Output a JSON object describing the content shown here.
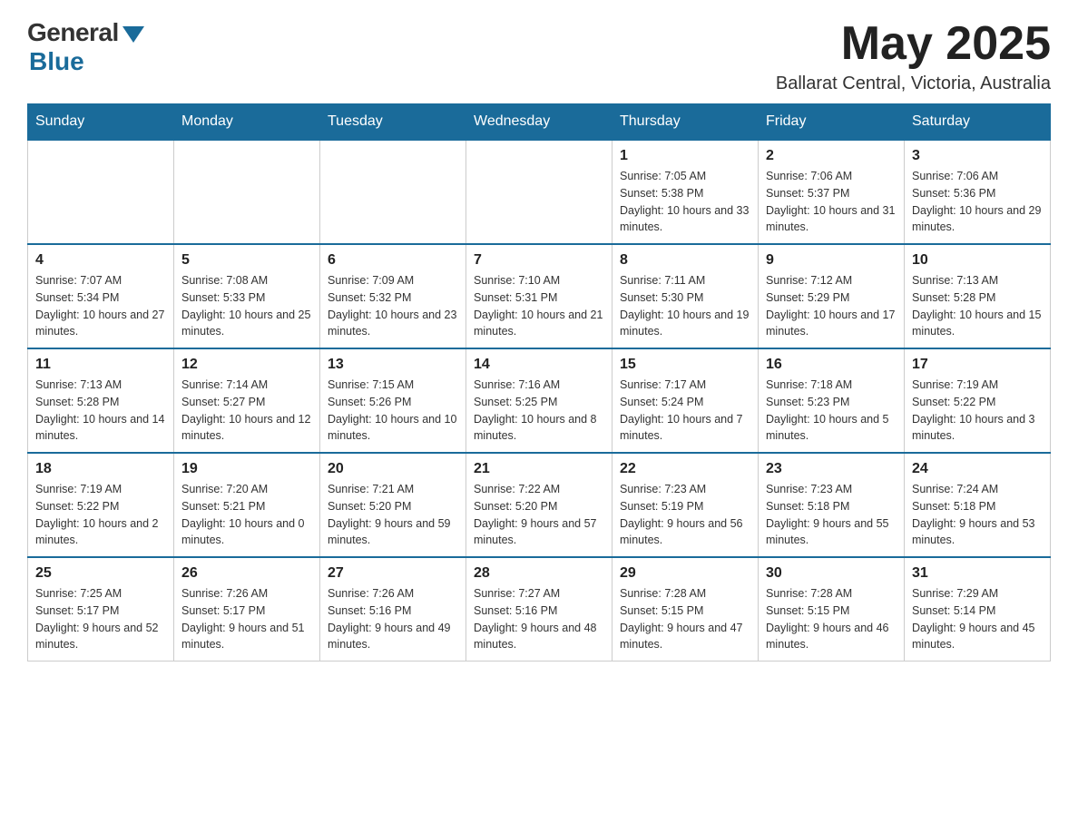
{
  "header": {
    "logo_general": "General",
    "logo_blue": "Blue",
    "month_title": "May 2025",
    "location": "Ballarat Central, Victoria, Australia"
  },
  "weekdays": [
    "Sunday",
    "Monday",
    "Tuesday",
    "Wednesday",
    "Thursday",
    "Friday",
    "Saturday"
  ],
  "weeks": [
    [
      {
        "day": "",
        "info": ""
      },
      {
        "day": "",
        "info": ""
      },
      {
        "day": "",
        "info": ""
      },
      {
        "day": "",
        "info": ""
      },
      {
        "day": "1",
        "info": "Sunrise: 7:05 AM\nSunset: 5:38 PM\nDaylight: 10 hours and 33 minutes."
      },
      {
        "day": "2",
        "info": "Sunrise: 7:06 AM\nSunset: 5:37 PM\nDaylight: 10 hours and 31 minutes."
      },
      {
        "day": "3",
        "info": "Sunrise: 7:06 AM\nSunset: 5:36 PM\nDaylight: 10 hours and 29 minutes."
      }
    ],
    [
      {
        "day": "4",
        "info": "Sunrise: 7:07 AM\nSunset: 5:34 PM\nDaylight: 10 hours and 27 minutes."
      },
      {
        "day": "5",
        "info": "Sunrise: 7:08 AM\nSunset: 5:33 PM\nDaylight: 10 hours and 25 minutes."
      },
      {
        "day": "6",
        "info": "Sunrise: 7:09 AM\nSunset: 5:32 PM\nDaylight: 10 hours and 23 minutes."
      },
      {
        "day": "7",
        "info": "Sunrise: 7:10 AM\nSunset: 5:31 PM\nDaylight: 10 hours and 21 minutes."
      },
      {
        "day": "8",
        "info": "Sunrise: 7:11 AM\nSunset: 5:30 PM\nDaylight: 10 hours and 19 minutes."
      },
      {
        "day": "9",
        "info": "Sunrise: 7:12 AM\nSunset: 5:29 PM\nDaylight: 10 hours and 17 minutes."
      },
      {
        "day": "10",
        "info": "Sunrise: 7:13 AM\nSunset: 5:28 PM\nDaylight: 10 hours and 15 minutes."
      }
    ],
    [
      {
        "day": "11",
        "info": "Sunrise: 7:13 AM\nSunset: 5:28 PM\nDaylight: 10 hours and 14 minutes."
      },
      {
        "day": "12",
        "info": "Sunrise: 7:14 AM\nSunset: 5:27 PM\nDaylight: 10 hours and 12 minutes."
      },
      {
        "day": "13",
        "info": "Sunrise: 7:15 AM\nSunset: 5:26 PM\nDaylight: 10 hours and 10 minutes."
      },
      {
        "day": "14",
        "info": "Sunrise: 7:16 AM\nSunset: 5:25 PM\nDaylight: 10 hours and 8 minutes."
      },
      {
        "day": "15",
        "info": "Sunrise: 7:17 AM\nSunset: 5:24 PM\nDaylight: 10 hours and 7 minutes."
      },
      {
        "day": "16",
        "info": "Sunrise: 7:18 AM\nSunset: 5:23 PM\nDaylight: 10 hours and 5 minutes."
      },
      {
        "day": "17",
        "info": "Sunrise: 7:19 AM\nSunset: 5:22 PM\nDaylight: 10 hours and 3 minutes."
      }
    ],
    [
      {
        "day": "18",
        "info": "Sunrise: 7:19 AM\nSunset: 5:22 PM\nDaylight: 10 hours and 2 minutes."
      },
      {
        "day": "19",
        "info": "Sunrise: 7:20 AM\nSunset: 5:21 PM\nDaylight: 10 hours and 0 minutes."
      },
      {
        "day": "20",
        "info": "Sunrise: 7:21 AM\nSunset: 5:20 PM\nDaylight: 9 hours and 59 minutes."
      },
      {
        "day": "21",
        "info": "Sunrise: 7:22 AM\nSunset: 5:20 PM\nDaylight: 9 hours and 57 minutes."
      },
      {
        "day": "22",
        "info": "Sunrise: 7:23 AM\nSunset: 5:19 PM\nDaylight: 9 hours and 56 minutes."
      },
      {
        "day": "23",
        "info": "Sunrise: 7:23 AM\nSunset: 5:18 PM\nDaylight: 9 hours and 55 minutes."
      },
      {
        "day": "24",
        "info": "Sunrise: 7:24 AM\nSunset: 5:18 PM\nDaylight: 9 hours and 53 minutes."
      }
    ],
    [
      {
        "day": "25",
        "info": "Sunrise: 7:25 AM\nSunset: 5:17 PM\nDaylight: 9 hours and 52 minutes."
      },
      {
        "day": "26",
        "info": "Sunrise: 7:26 AM\nSunset: 5:17 PM\nDaylight: 9 hours and 51 minutes."
      },
      {
        "day": "27",
        "info": "Sunrise: 7:26 AM\nSunset: 5:16 PM\nDaylight: 9 hours and 49 minutes."
      },
      {
        "day": "28",
        "info": "Sunrise: 7:27 AM\nSunset: 5:16 PM\nDaylight: 9 hours and 48 minutes."
      },
      {
        "day": "29",
        "info": "Sunrise: 7:28 AM\nSunset: 5:15 PM\nDaylight: 9 hours and 47 minutes."
      },
      {
        "day": "30",
        "info": "Sunrise: 7:28 AM\nSunset: 5:15 PM\nDaylight: 9 hours and 46 minutes."
      },
      {
        "day": "31",
        "info": "Sunrise: 7:29 AM\nSunset: 5:14 PM\nDaylight: 9 hours and 45 minutes."
      }
    ]
  ]
}
